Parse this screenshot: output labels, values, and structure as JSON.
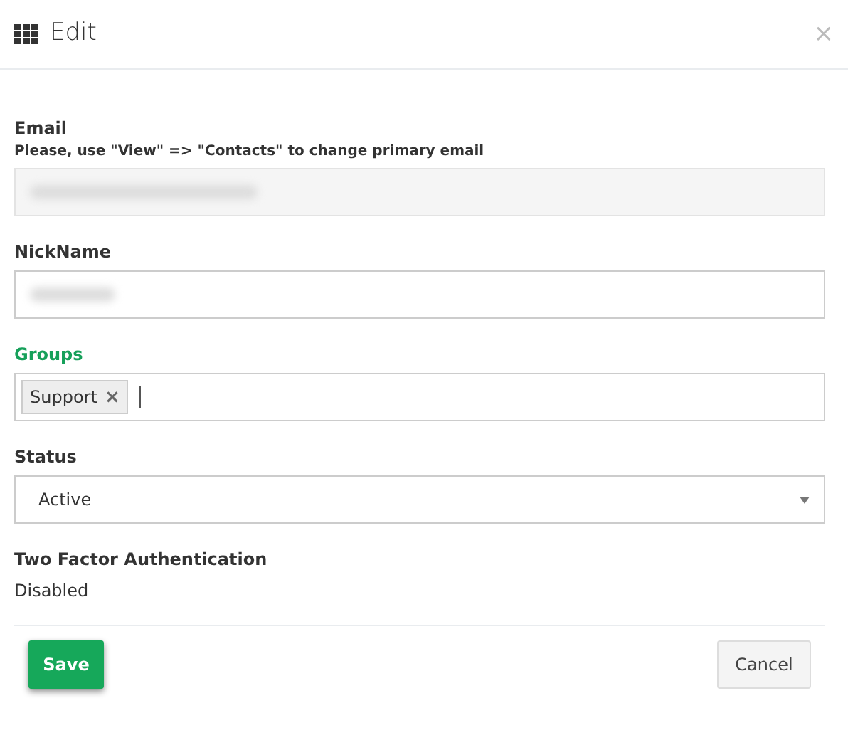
{
  "dialog": {
    "title": "Edit",
    "close": "×"
  },
  "fields": [
    {
      "kind": "text",
      "label": "Email",
      "hint": "Please, use \"View\" => \"Contacts\" to change primary email",
      "disabled": true,
      "redacted": true,
      "highlighted": false
    },
    {
      "kind": "text",
      "label": "NickName",
      "disabled": false,
      "redacted": true,
      "highlighted": false
    },
    {
      "kind": "tags",
      "label": "Groups",
      "highlighted": true,
      "tags": [
        {
          "text": "Support",
          "remove": "×"
        }
      ]
    },
    {
      "kind": "select",
      "label": "Status",
      "value": "Active",
      "highlighted": false
    },
    {
      "kind": "static",
      "label": "Two Factor Authentication",
      "value": "Disabled",
      "highlighted": false
    }
  ],
  "buttons": [
    {
      "label": "Save",
      "kind": "primary"
    },
    {
      "label": "Cancel",
      "kind": "secondary"
    }
  ]
}
